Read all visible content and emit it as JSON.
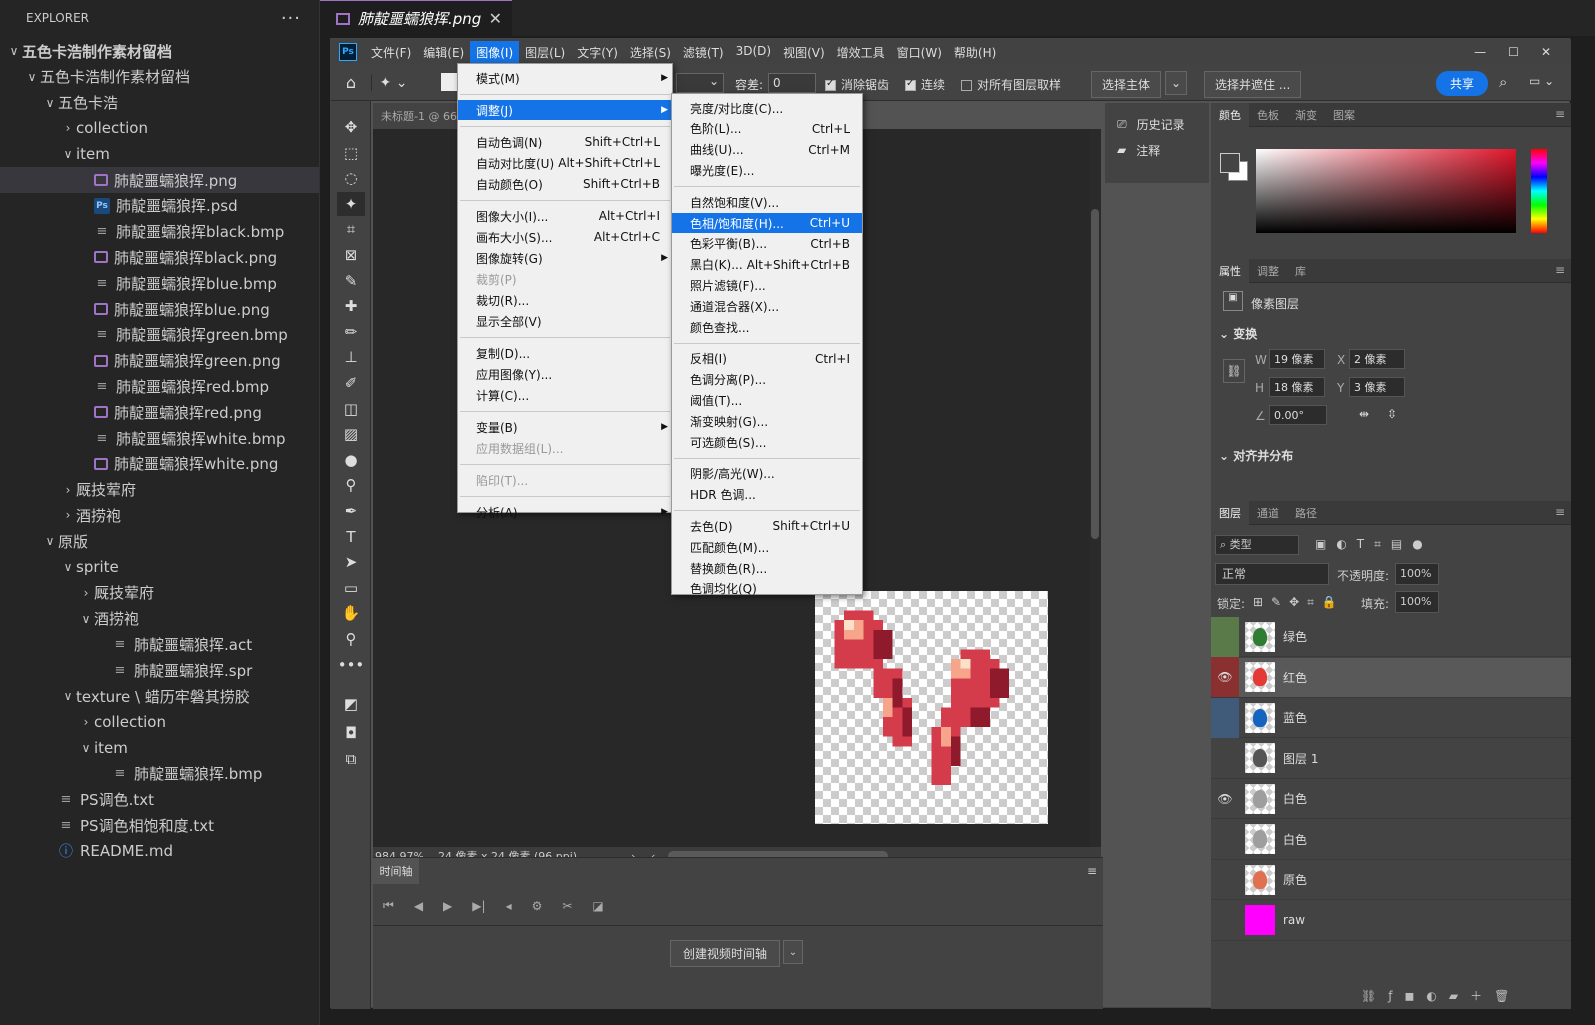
{
  "explorer": {
    "title": "EXPLORER",
    "more": "···",
    "items": [
      {
        "label": "五色卡浩制作素材留档",
        "indent": 0,
        "tw": "∨",
        "icon": "",
        "kind": "root",
        "sel": false
      },
      {
        "label": "五色卡浩制作素材留档",
        "indent": 1,
        "tw": "∨",
        "icon": "",
        "kind": "folder",
        "sel": false
      },
      {
        "label": "五色卡浩",
        "indent": 2,
        "tw": "∨",
        "icon": "",
        "kind": "folder",
        "sel": false
      },
      {
        "label": "collection",
        "indent": 3,
        "tw": "›",
        "icon": "",
        "kind": "folder",
        "sel": false
      },
      {
        "label": "item",
        "indent": 3,
        "tw": "∨",
        "icon": "",
        "kind": "folder",
        "sel": false
      },
      {
        "label": "肺靛噩蠕狼挥.png",
        "indent": 4,
        "tw": "",
        "icon": "img",
        "kind": "file",
        "sel": true
      },
      {
        "label": "肺靛噩蠕狼挥.psd",
        "indent": 4,
        "tw": "",
        "icon": "psd",
        "kind": "file",
        "sel": false
      },
      {
        "label": "肺靛噩蠕狼挥black.bmp",
        "indent": 4,
        "tw": "",
        "icon": "txt",
        "kind": "file",
        "sel": false
      },
      {
        "label": "肺靛噩蠕狼挥black.png",
        "indent": 4,
        "tw": "",
        "icon": "img",
        "kind": "file",
        "sel": false
      },
      {
        "label": "肺靛噩蠕狼挥blue.bmp",
        "indent": 4,
        "tw": "",
        "icon": "txt",
        "kind": "file",
        "sel": false
      },
      {
        "label": "肺靛噩蠕狼挥blue.png",
        "indent": 4,
        "tw": "",
        "icon": "img",
        "kind": "file",
        "sel": false
      },
      {
        "label": "肺靛噩蠕狼挥green.bmp",
        "indent": 4,
        "tw": "",
        "icon": "txt",
        "kind": "file",
        "sel": false
      },
      {
        "label": "肺靛噩蠕狼挥green.png",
        "indent": 4,
        "tw": "",
        "icon": "img",
        "kind": "file",
        "sel": false
      },
      {
        "label": "肺靛噩蠕狼挥red.bmp",
        "indent": 4,
        "tw": "",
        "icon": "txt",
        "kind": "file",
        "sel": false
      },
      {
        "label": "肺靛噩蠕狼挥red.png",
        "indent": 4,
        "tw": "",
        "icon": "img",
        "kind": "file",
        "sel": false
      },
      {
        "label": "肺靛噩蠕狼挥white.bmp",
        "indent": 4,
        "tw": "",
        "icon": "txt",
        "kind": "file",
        "sel": false
      },
      {
        "label": "肺靛噩蠕狼挥white.png",
        "indent": 4,
        "tw": "",
        "icon": "img",
        "kind": "file",
        "sel": false
      },
      {
        "label": "厩技荤府",
        "indent": 3,
        "tw": "›",
        "icon": "",
        "kind": "folder",
        "sel": false
      },
      {
        "label": "酒捞袍",
        "indent": 3,
        "tw": "›",
        "icon": "",
        "kind": "folder",
        "sel": false
      },
      {
        "label": "原版",
        "indent": 2,
        "tw": "∨",
        "icon": "",
        "kind": "folder",
        "sel": false
      },
      {
        "label": "sprite",
        "indent": 3,
        "tw": "∨",
        "icon": "",
        "kind": "folder",
        "sel": false
      },
      {
        "label": "厩技荤府",
        "indent": 4,
        "tw": "›",
        "icon": "",
        "kind": "folder",
        "sel": false
      },
      {
        "label": "酒捞袍",
        "indent": 4,
        "tw": "∨",
        "icon": "",
        "kind": "folder",
        "sel": false
      },
      {
        "label": "肺靛噩蠕狼挥.act",
        "indent": 5,
        "tw": "",
        "icon": "txt",
        "kind": "file",
        "sel": false
      },
      {
        "label": "肺靛噩蠕狼挥.spr",
        "indent": 5,
        "tw": "",
        "icon": "txt",
        "kind": "file",
        "sel": false
      },
      {
        "label": "texture \\ 蜡历牢磐其捞胶",
        "indent": 3,
        "tw": "∨",
        "icon": "",
        "kind": "folder",
        "sel": false
      },
      {
        "label": "collection",
        "indent": 4,
        "tw": "›",
        "icon": "",
        "kind": "folder",
        "sel": false
      },
      {
        "label": "item",
        "indent": 4,
        "tw": "∨",
        "icon": "",
        "kind": "folder",
        "sel": false
      },
      {
        "label": "肺靛噩蠕狼挥.bmp",
        "indent": 5,
        "tw": "",
        "icon": "txt",
        "kind": "file",
        "sel": false
      },
      {
        "label": "PS调色.txt",
        "indent": 2,
        "tw": "",
        "icon": "txt",
        "kind": "file",
        "sel": false
      },
      {
        "label": "PS调色相饱和度.txt",
        "indent": 2,
        "tw": "",
        "icon": "txt",
        "kind": "file",
        "sel": false
      },
      {
        "label": "README.md",
        "indent": 2,
        "tw": "",
        "icon": "info",
        "kind": "file",
        "sel": false
      }
    ]
  },
  "editor_tab": {
    "label": "肺靛噩蠕狼挥.png",
    "close": "✕"
  },
  "ps": {
    "logo": "Ps",
    "menus": [
      "文件(F)",
      "编辑(E)",
      "图像(I)",
      "图层(L)",
      "文字(Y)",
      "选择(S)",
      "滤镜(T)",
      "3D(D)",
      "视图(V)",
      "增效工具",
      "窗口(W)",
      "帮助(H)"
    ],
    "active_menu_index": 2,
    "window_buttons": [
      "—",
      "☐",
      "✕"
    ],
    "options": {
      "tolerance_label": "容差:",
      "tolerance_value": "0",
      "antialias": "消除锯齿",
      "contiguous": "连续",
      "all_layers": "对所有图层取样",
      "select_subject": "选择主体",
      "select_mask": "选择并遮住 ...",
      "share": "共享"
    },
    "doc_tab": "未标题-1 @ 66",
    "status": {
      "zoom": "984.97%",
      "size": "24 像素 x 24 像素 (96 ppi)"
    },
    "timeline": {
      "title": "时间轴",
      "create": "创建视频时间轴"
    },
    "history": [
      {
        "label": "历史记录",
        "icon": "history-icon"
      },
      {
        "label": "注释",
        "icon": "comment-icon"
      }
    ],
    "color_tabs": [
      "颜色",
      "色板",
      "渐变",
      "图案"
    ],
    "props_tabs": [
      "属性",
      "调整",
      "库"
    ],
    "props": {
      "pixel_layer": "像素图层",
      "transform": "变换",
      "w_label": "W",
      "w": "19 像素",
      "h_label": "H",
      "h": "18 像素",
      "x_label": "X",
      "x": "2 像素",
      "y_label": "Y",
      "y": "3 像素",
      "angle": "0.00°",
      "align": "对齐并分布"
    },
    "layer_tabs": [
      "图层",
      "通道",
      "路径"
    ],
    "layer_filter": "类型",
    "blend_mode": "正常",
    "opacity_label": "不透明度:",
    "opacity": "100%",
    "lock_label": "锁定:",
    "fill_label": "填充:",
    "fill": "100%",
    "layers": [
      {
        "name": "绿色",
        "visible": false,
        "tag": "#5a7a4a",
        "color": "#2e7d32",
        "sel": false
      },
      {
        "name": "红色",
        "visible": true,
        "tag": "#8a3030",
        "color": "#e53935",
        "sel": true
      },
      {
        "name": "蓝色",
        "visible": false,
        "tag": "#405a7a",
        "color": "#1565c0",
        "sel": false
      },
      {
        "name": "图层 1",
        "visible": false,
        "tag": "",
        "color": "#555555",
        "sel": false
      },
      {
        "name": "白色",
        "visible": true,
        "tag": "",
        "color": "#9e9e9e",
        "sel": false
      },
      {
        "name": "白色",
        "visible": false,
        "tag": "",
        "color": "#9e9e9e",
        "sel": false
      },
      {
        "name": "原色",
        "visible": false,
        "tag": "",
        "color": "#e07050",
        "sel": false
      },
      {
        "name": "raw",
        "visible": false,
        "tag": "",
        "color": "#ff00ff",
        "sel": false
      }
    ]
  },
  "image_menu": [
    {
      "label": "模式(M)",
      "sc": "",
      "sub": true,
      "dis": false,
      "hl": false
    },
    {
      "sep": true
    },
    {
      "label": "调整(J)",
      "sc": "",
      "sub": true,
      "dis": false,
      "hl": true
    },
    {
      "sep": true
    },
    {
      "label": "自动色调(N)",
      "sc": "Shift+Ctrl+L",
      "sub": false,
      "dis": false,
      "hl": false
    },
    {
      "label": "自动对比度(U)",
      "sc": "Alt+Shift+Ctrl+L",
      "sub": false,
      "dis": false,
      "hl": false
    },
    {
      "label": "自动颜色(O)",
      "sc": "Shift+Ctrl+B",
      "sub": false,
      "dis": false,
      "hl": false
    },
    {
      "sep": true
    },
    {
      "label": "图像大小(I)...",
      "sc": "Alt+Ctrl+I",
      "sub": false,
      "dis": false,
      "hl": false
    },
    {
      "label": "画布大小(S)...",
      "sc": "Alt+Ctrl+C",
      "sub": false,
      "dis": false,
      "hl": false
    },
    {
      "label": "图像旋转(G)",
      "sc": "",
      "sub": true,
      "dis": false,
      "hl": false
    },
    {
      "label": "裁剪(P)",
      "sc": "",
      "sub": false,
      "dis": true,
      "hl": false
    },
    {
      "label": "裁切(R)...",
      "sc": "",
      "sub": false,
      "dis": false,
      "hl": false
    },
    {
      "label": "显示全部(V)",
      "sc": "",
      "sub": false,
      "dis": false,
      "hl": false
    },
    {
      "sep": true
    },
    {
      "label": "复制(D)...",
      "sc": "",
      "sub": false,
      "dis": false,
      "hl": false
    },
    {
      "label": "应用图像(Y)...",
      "sc": "",
      "sub": false,
      "dis": false,
      "hl": false
    },
    {
      "label": "计算(C)...",
      "sc": "",
      "sub": false,
      "dis": false,
      "hl": false
    },
    {
      "sep": true
    },
    {
      "label": "变量(B)",
      "sc": "",
      "sub": true,
      "dis": false,
      "hl": false
    },
    {
      "label": "应用数据组(L)...",
      "sc": "",
      "sub": false,
      "dis": true,
      "hl": false
    },
    {
      "sep": true
    },
    {
      "label": "陷印(T)...",
      "sc": "",
      "sub": false,
      "dis": true,
      "hl": false
    },
    {
      "sep": true
    },
    {
      "label": "分析(A)",
      "sc": "",
      "sub": true,
      "dis": false,
      "hl": false
    }
  ],
  "adjust_menu": [
    {
      "label": "亮度/对比度(C)...",
      "sc": "",
      "hl": false
    },
    {
      "label": "色阶(L)...",
      "sc": "Ctrl+L",
      "hl": false
    },
    {
      "label": "曲线(U)...",
      "sc": "Ctrl+M",
      "hl": false
    },
    {
      "label": "曝光度(E)...",
      "sc": "",
      "hl": false
    },
    {
      "sep": true
    },
    {
      "label": "自然饱和度(V)...",
      "sc": "",
      "hl": false
    },
    {
      "label": "色相/饱和度(H)...",
      "sc": "Ctrl+U",
      "hl": true
    },
    {
      "label": "色彩平衡(B)...",
      "sc": "Ctrl+B",
      "hl": false
    },
    {
      "label": "黑白(K)...",
      "sc": "Alt+Shift+Ctrl+B",
      "hl": false
    },
    {
      "label": "照片滤镜(F)...",
      "sc": "",
      "hl": false
    },
    {
      "label": "通道混合器(X)...",
      "sc": "",
      "hl": false
    },
    {
      "label": "颜色查找...",
      "sc": "",
      "hl": false
    },
    {
      "sep": true
    },
    {
      "label": "反相(I)",
      "sc": "Ctrl+I",
      "hl": false
    },
    {
      "label": "色调分离(P)...",
      "sc": "",
      "hl": false
    },
    {
      "label": "阈值(T)...",
      "sc": "",
      "hl": false
    },
    {
      "label": "渐变映射(G)...",
      "sc": "",
      "hl": false
    },
    {
      "label": "可选颜色(S)...",
      "sc": "",
      "hl": false
    },
    {
      "sep": true
    },
    {
      "label": "阴影/高光(W)...",
      "sc": "",
      "hl": false
    },
    {
      "label": "HDR 色调...",
      "sc": "",
      "hl": false
    },
    {
      "sep": true
    },
    {
      "label": "去色(D)",
      "sc": "Shift+Ctrl+U",
      "hl": false
    },
    {
      "label": "匹配颜色(M)...",
      "sc": "",
      "hl": false
    },
    {
      "label": "替换颜色(R)...",
      "sc": "",
      "hl": false
    },
    {
      "label": "色调均化(Q)",
      "sc": "",
      "hl": false
    }
  ],
  "tools": [
    "move-tool-icon",
    "marquee-tool-icon",
    "lasso-tool-icon",
    "magic-wand-tool-icon",
    "crop-tool-icon",
    "frame-tool-icon",
    "eyedropper-tool-icon",
    "healing-brush-icon",
    "brush-tool-icon",
    "stamp-tool-icon",
    "history-brush-icon",
    "eraser-tool-icon",
    "paint-bucket-icon",
    "blur-tool-icon",
    "dodge-tool-icon",
    "pen-tool-icon",
    "type-tool-icon",
    "path-select-icon",
    "rectangle-tool-icon",
    "hand-tool-icon",
    "zoom-tool-icon",
    "more-tools-icon"
  ]
}
